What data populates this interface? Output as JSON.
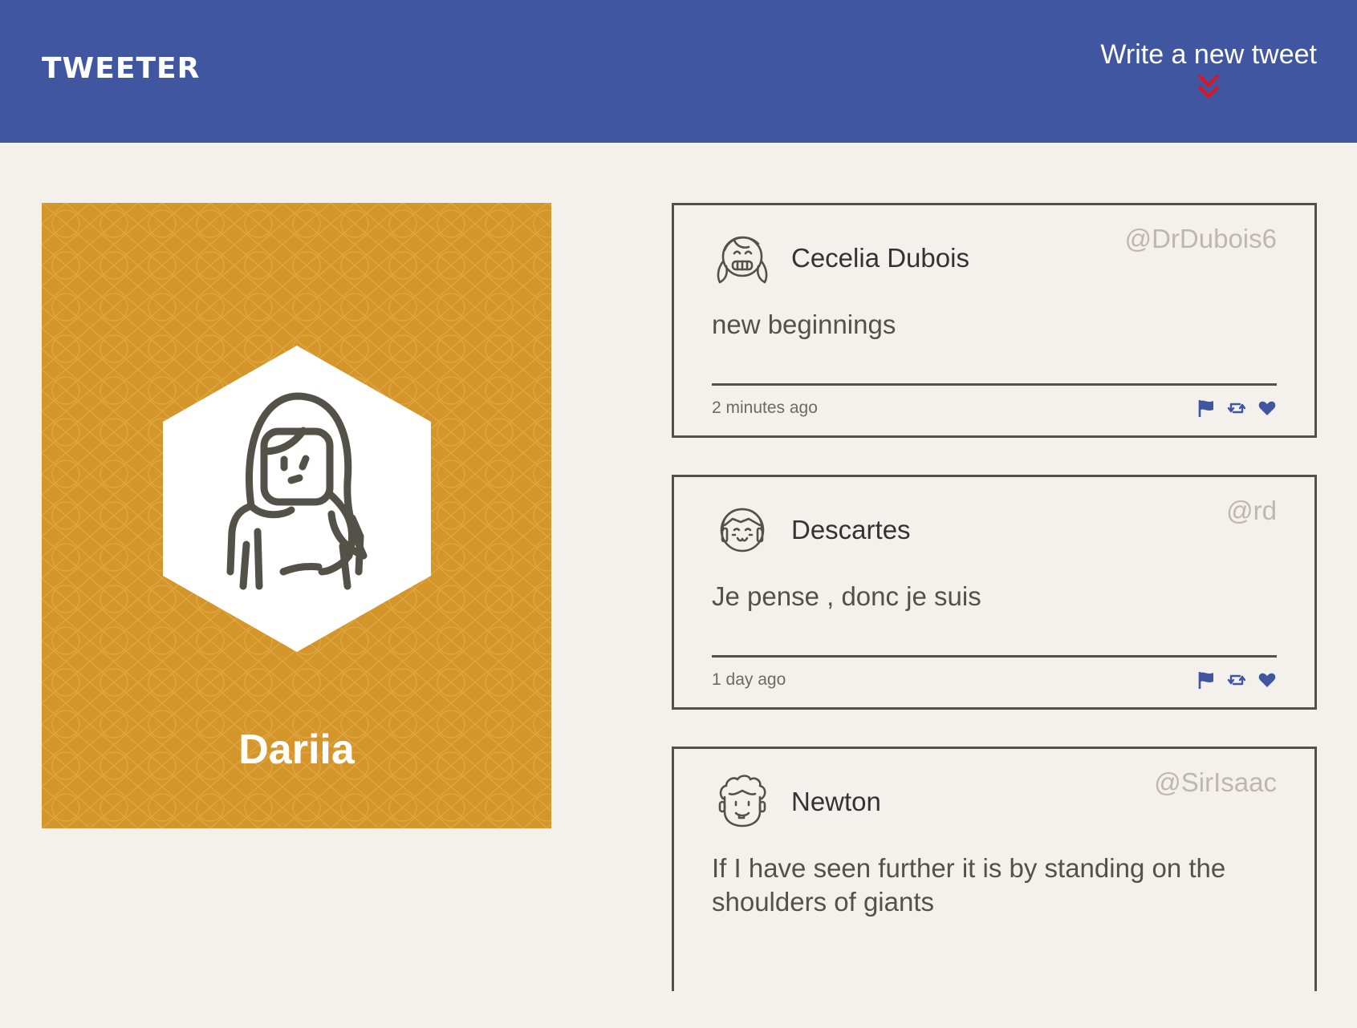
{
  "header": {
    "logo": "TWEETER",
    "compose_label": "Write a new tweet"
  },
  "colors": {
    "header_bg": "#4056a1",
    "page_bg": "#f4f1ec",
    "profile_bg": "#d4962a",
    "accent_arrow": "#e0141e",
    "action_icon": "#4056a1"
  },
  "profile": {
    "name": "Dariia"
  },
  "tweets": [
    {
      "name": "Cecelia Dubois",
      "handle": "@DrDubois6",
      "text": "new beginnings",
      "time": "2 minutes ago",
      "avatar_icon": "smiling-girl-avatar-icon"
    },
    {
      "name": "Descartes",
      "handle": "@rd",
      "text": "Je pense , donc je suis",
      "time": "1 day ago",
      "avatar_icon": "bob-haircut-avatar-icon"
    },
    {
      "name": "Newton",
      "handle": "@SirIsaac",
      "text": "If I have seen further it is by standing on the shoulders of giants",
      "avatar_icon": "curly-hair-avatar-icon"
    }
  ]
}
